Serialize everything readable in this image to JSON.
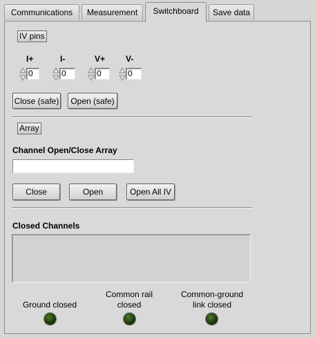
{
  "tabs": [
    {
      "label": "Communications"
    },
    {
      "label": "Measurement"
    },
    {
      "label": "Switchboard"
    },
    {
      "label": "Save data"
    }
  ],
  "iv_pins": {
    "button_label": "IV pins",
    "controls": [
      {
        "label": "I+",
        "value": "0"
      },
      {
        "label": "I-",
        "value": "0"
      },
      {
        "label": "V+",
        "value": "0"
      },
      {
        "label": "V-",
        "value": "0"
      }
    ],
    "close_safe_label": "Close (safe)",
    "open_safe_label": "Open (safe)"
  },
  "array": {
    "button_label": "Array",
    "channel_label": "Channel Open/Close Array",
    "channel_value": "",
    "close_label": "Close",
    "open_label": "Open",
    "open_all_iv_label": "Open All IV"
  },
  "closed_channels": {
    "label": "Closed Channels",
    "value": ""
  },
  "indicators": [
    {
      "label": "Ground closed",
      "state": "off"
    },
    {
      "label": "Common rail closed",
      "state": "off"
    },
    {
      "label": "Common-ground link closed",
      "state": "off"
    }
  ]
}
